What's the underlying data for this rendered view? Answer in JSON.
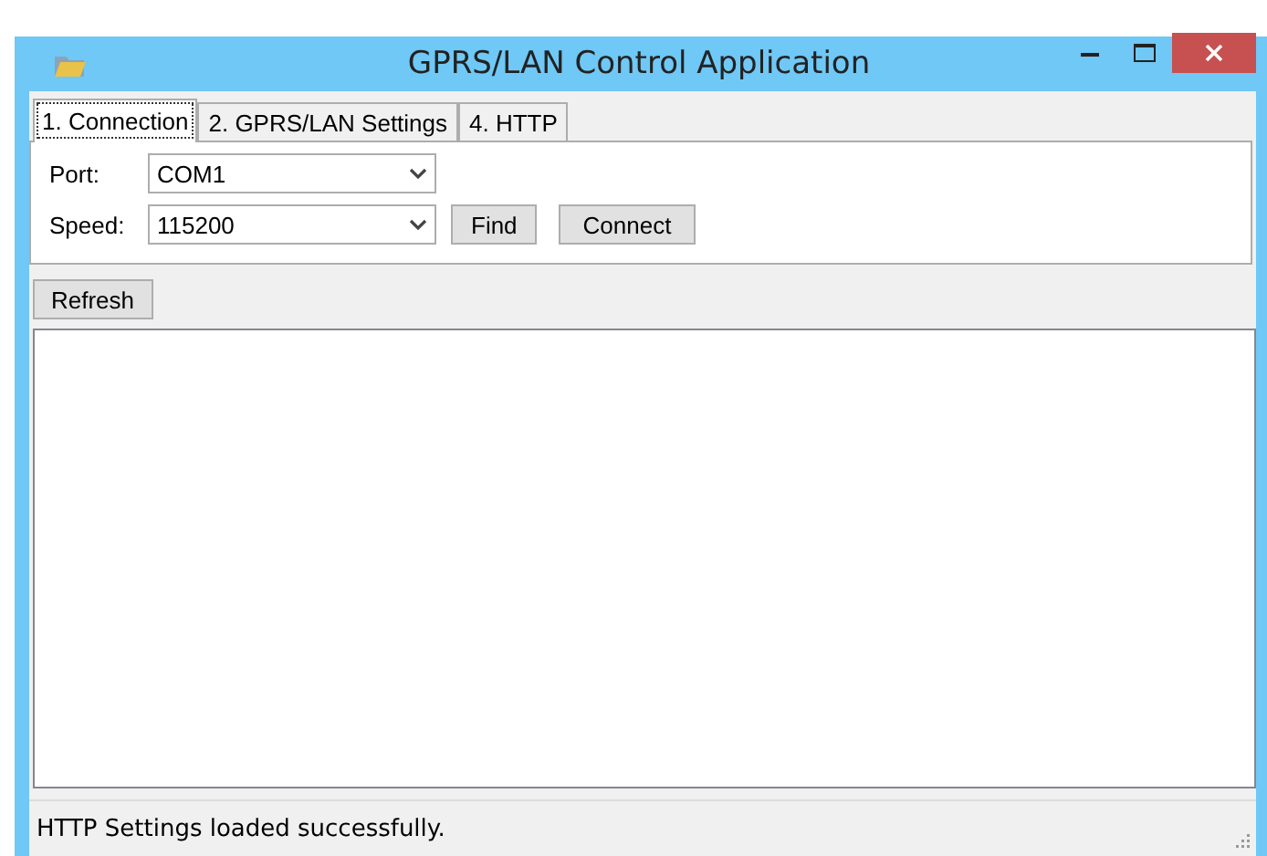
{
  "window": {
    "title": "GPRS/LAN Control Application"
  },
  "tabs": [
    {
      "label": "1. Connection",
      "selected": true
    },
    {
      "label": "2. GPRS/LAN Settings",
      "selected": false
    },
    {
      "label": "4. HTTP",
      "selected": false
    }
  ],
  "connection": {
    "port": {
      "label": "Port:",
      "value": "COM1"
    },
    "speed": {
      "label": "Speed:",
      "value": "115200"
    },
    "buttons": [
      "Find",
      "Connect"
    ]
  },
  "refresh_button": "Refresh",
  "status_bar": "HTTP Settings loaded successfully."
}
